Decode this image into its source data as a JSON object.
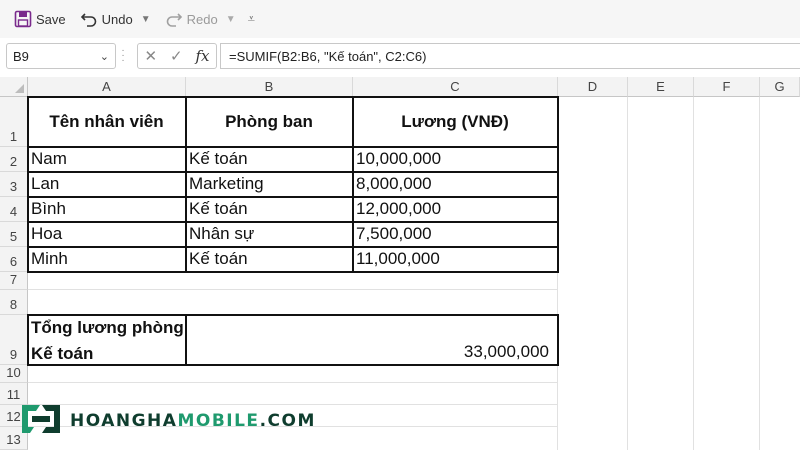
{
  "quick_access": {
    "save_label": "Save",
    "undo_label": "Undo",
    "redo_label": "Redo"
  },
  "formula_bar": {
    "name_box": "B9",
    "formula": "=SUMIF(B2:B6, \"Kế toán\", C2:C6)"
  },
  "columns": [
    "A",
    "B",
    "C",
    "D",
    "E",
    "F",
    "G"
  ],
  "rows": [
    "1",
    "2",
    "3",
    "4",
    "5",
    "6",
    "7",
    "8",
    "9",
    "10",
    "11",
    "12",
    "13"
  ],
  "table": {
    "headers": [
      "Tên nhân viên",
      "Phòng ban",
      "Lương (VNĐ)"
    ],
    "rows": [
      [
        "Nam",
        "Kế toán",
        "10,000,000"
      ],
      [
        "Lan",
        "Marketing",
        "8,000,000"
      ],
      [
        "Bình",
        "Kế toán",
        "12,000,000"
      ],
      [
        "Hoa",
        "Nhân sự",
        "7,500,000"
      ],
      [
        "Minh",
        "Kế toán",
        "11,000,000"
      ]
    ]
  },
  "total": {
    "label": "Tổng lương phòng Kế toán",
    "value": "33,000,000"
  },
  "watermark": {
    "part1": "HOANGHA",
    "part2": "MOBILE",
    "part3": ".COM"
  },
  "colors": {
    "accent": "#7a2a8c",
    "brand_dark": "#0f3d2e",
    "brand_green": "#1f9a6e"
  }
}
